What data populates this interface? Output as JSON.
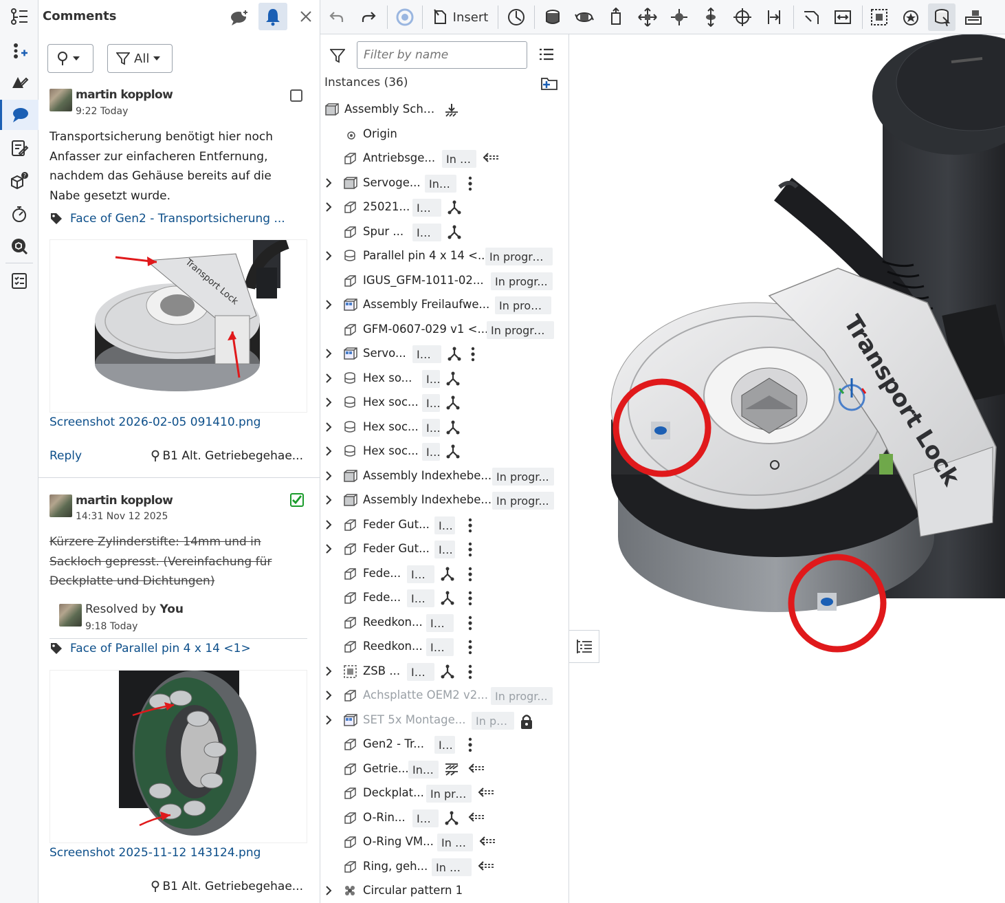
{
  "comments_panel": {
    "title": "Comments",
    "filter_all_label": "All",
    "comments": [
      {
        "author": "martin kopplow",
        "time": "9:22 Today",
        "resolved": false,
        "text": "Transportsicherung benötigt hier noch Anfasser zur einfacheren Entfernung, nachdem das Gehäuse bereits auf die Nabe gesetzt wurde.",
        "tag": "Face of Gen2 - Transportsicherung ...",
        "image_label": "Transport Lock",
        "filename": "Screenshot 2026-02-05 091410.png",
        "reply_label": "Reply",
        "location": "B1 Alt. Getriebegehae..."
      },
      {
        "author": "martin kopplow",
        "time": "14:31 Nov 12 2025",
        "resolved": true,
        "text": "Kürzere Zylinderstifte: 14mm und in Sackloch gepresst. (Vereinfachung für Deckplatte und Dichtungen)",
        "resolved_prefix": "Resolved by",
        "resolved_by": "You",
        "resolved_time": "9:18 Today",
        "tag": "Face of Parallel pin 4 x 14 <1>",
        "filename": "Screenshot 2025-11-12 143124.png",
        "location": "B1 Alt. Getriebegehae..."
      }
    ]
  },
  "toolbar": {
    "insert_label": "Insert",
    "icons": [
      "undo-icon",
      "redo-icon",
      "update-icon",
      "insert-icon",
      "measure-icon",
      "fastened-mate-icon",
      "revolute-mate-icon",
      "slider-mate-icon",
      "planar-mate-icon",
      "ball-mate-icon",
      "cylindrical-mate-icon",
      "pin-slot-mate-icon",
      "parallel-mate-icon",
      "tangent-mate-icon",
      "width-mate-icon",
      "group-icon",
      "replicate-icon",
      "mate-connector-icon",
      "explode-icon"
    ]
  },
  "instances_panel": {
    "search_placeholder": "Filter by name",
    "title": "Instances (36)",
    "rows": [
      {
        "name": "Assembly Scha...",
        "status": "",
        "chevron": false,
        "indent": 0,
        "icon": "assembly-icon",
        "tail": [
          "fix-icon"
        ]
      },
      {
        "name": "Origin",
        "status": "",
        "chevron": false,
        "indent": 1,
        "icon": "origin-icon",
        "tail": []
      },
      {
        "name": "Antriebsge...",
        "status": "In p...",
        "chevron": false,
        "indent": 1,
        "icon": "part-icon",
        "tail": [
          "mate-arrow-icon"
        ]
      },
      {
        "name": "Servoge...",
        "status": "In ...",
        "chevron": true,
        "indent": 1,
        "icon": "assembly-icon",
        "tail": [
          "dots-icon"
        ]
      },
      {
        "name": "25021...",
        "status": "In...",
        "chevron": true,
        "indent": 1,
        "icon": "part-icon",
        "tail": [
          "mate-triad-icon"
        ]
      },
      {
        "name": "Spur ...",
        "status": "In...",
        "chevron": false,
        "indent": 1,
        "icon": "part-icon",
        "tail": [
          "mate-triad-icon"
        ]
      },
      {
        "name": "Parallel pin 4 x 14 <...",
        "status": "In progre...",
        "chevron": true,
        "indent": 1,
        "icon": "standard-part-icon",
        "tail": []
      },
      {
        "name": "IGUS_GFM-1011-02...",
        "status": "In progr...",
        "chevron": false,
        "indent": 1,
        "icon": "part-icon",
        "tail": []
      },
      {
        "name": "Assembly Freilaufwe...",
        "status": "In prog...",
        "chevron": true,
        "indent": 1,
        "icon": "assembly-blue-icon",
        "tail": []
      },
      {
        "name": "GFM-0607-029 v1 <...",
        "status": "In progre...",
        "chevron": false,
        "indent": 1,
        "icon": "part-icon",
        "tail": []
      },
      {
        "name": "Servo...",
        "status": "In...",
        "chevron": true,
        "indent": 1,
        "icon": "assembly-blue-icon",
        "tail": [
          "mate-triad-icon",
          "dots-icon"
        ]
      },
      {
        "name": "Hex so...",
        "status": "I...",
        "chevron": true,
        "indent": 1,
        "icon": "standard-part-icon",
        "tail": [
          "mate-triad-icon"
        ]
      },
      {
        "name": "Hex soc...",
        "status": "I...",
        "chevron": true,
        "indent": 1,
        "icon": "standard-part-icon",
        "tail": [
          "mate-triad-icon"
        ]
      },
      {
        "name": "Hex soc...",
        "status": "I...",
        "chevron": true,
        "indent": 1,
        "icon": "standard-part-icon",
        "tail": [
          "mate-triad-icon"
        ]
      },
      {
        "name": "Hex soc...",
        "status": "I...",
        "chevron": true,
        "indent": 1,
        "icon": "standard-part-icon",
        "tail": [
          "mate-triad-icon"
        ]
      },
      {
        "name": "Assembly Indexhebe...",
        "status": "In progr...",
        "chevron": true,
        "indent": 1,
        "icon": "assembly-icon",
        "tail": []
      },
      {
        "name": "Assembly Indexhebe...",
        "status": "In progr...",
        "chevron": true,
        "indent": 1,
        "icon": "assembly-icon",
        "tail": []
      },
      {
        "name": "Feder Gut...",
        "status": "I...",
        "chevron": true,
        "indent": 1,
        "icon": "part-icon",
        "tail": [
          "dots-icon"
        ]
      },
      {
        "name": "Feder Gut...",
        "status": "I...",
        "chevron": true,
        "indent": 1,
        "icon": "part-icon",
        "tail": [
          "dots-icon"
        ]
      },
      {
        "name": "Fede...",
        "status": "In ...",
        "chevron": false,
        "indent": 1,
        "icon": "part-icon",
        "tail": [
          "mate-triad-icon",
          "dots-icon"
        ]
      },
      {
        "name": "Fede...",
        "status": "In ...",
        "chevron": false,
        "indent": 1,
        "icon": "part-icon",
        "tail": [
          "mate-triad-icon",
          "dots-icon"
        ]
      },
      {
        "name": "Reedkon...",
        "status": "In ...",
        "chevron": false,
        "indent": 1,
        "icon": "part-icon",
        "tail": [
          "dots-icon"
        ]
      },
      {
        "name": "Reedkon...",
        "status": "In ...",
        "chevron": false,
        "indent": 1,
        "icon": "part-icon",
        "tail": [
          "dots-icon"
        ]
      },
      {
        "name": "ZSB ...",
        "status": "In ...",
        "chevron": true,
        "indent": 1,
        "icon": "group-part-icon",
        "tail": [
          "mate-triad-icon",
          "dots-icon"
        ]
      },
      {
        "name": "Achsplatte OEM2 v2...",
        "status": "In progr...",
        "chevron": true,
        "indent": 1,
        "icon": "part-icon",
        "dim": true,
        "tail": []
      },
      {
        "name": "SET 5x Montage...",
        "status": "In pr...",
        "chevron": true,
        "indent": 1,
        "icon": "assembly-blue-icon",
        "dim": true,
        "tail": [
          "lock-icon"
        ]
      },
      {
        "name": "Gen2 - Tr...",
        "status": "I...",
        "chevron": false,
        "indent": 1,
        "icon": "part-icon",
        "tail": [
          "dots-icon"
        ]
      },
      {
        "name": "Getrie...",
        "status": "In ...",
        "chevron": false,
        "indent": 1,
        "icon": "part-icon",
        "tail": [
          "hatch-icon",
          "mate-arrow-icon"
        ]
      },
      {
        "name": "Deckplat...",
        "status": "In pro...",
        "chevron": false,
        "indent": 1,
        "icon": "part-icon",
        "tail": [
          "mate-arrow-icon"
        ]
      },
      {
        "name": "O-Rin...",
        "status": "In...",
        "chevron": false,
        "indent": 1,
        "icon": "part-icon",
        "tail": [
          "mate-triad-icon",
          "mate-arrow-icon"
        ]
      },
      {
        "name": "O-Ring VM...",
        "status": "In p...",
        "chevron": false,
        "indent": 1,
        "icon": "part-icon",
        "tail": [
          "mate-arrow-icon"
        ]
      },
      {
        "name": "Ring, geh...",
        "status": "In pr...",
        "chevron": false,
        "indent": 1,
        "icon": "part-icon",
        "tail": [
          "mate-arrow-icon"
        ]
      },
      {
        "name": "Circular pattern 1",
        "status": "",
        "chevron": true,
        "indent": 1,
        "icon": "pattern-icon",
        "tail": []
      }
    ]
  },
  "viewport": {
    "label": "Transport Lock",
    "accent": "#e0191b"
  },
  "colors": {
    "accent_blue": "#1b5fb4",
    "link": "#0d4f8a",
    "success": "#1a9b2b",
    "annotation_red": "#e0191b"
  }
}
